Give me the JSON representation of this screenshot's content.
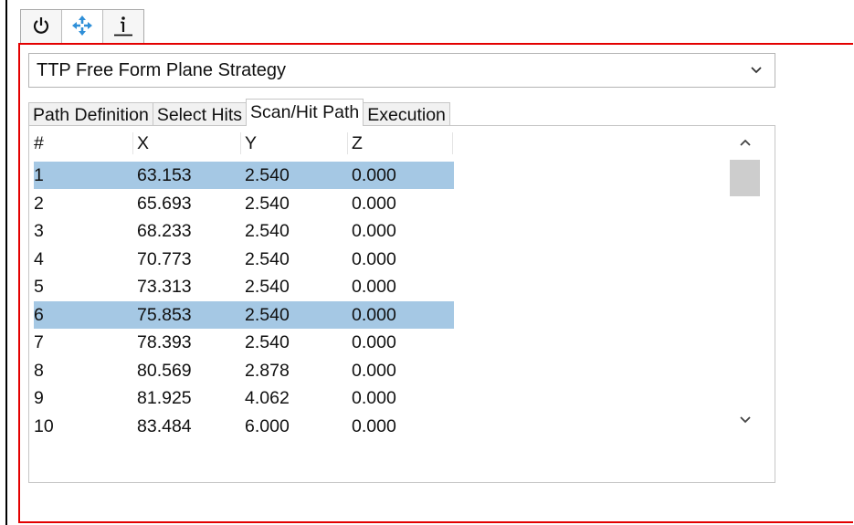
{
  "toolbar": {
    "buttons": [
      {
        "icon": "power-icon",
        "active": false
      },
      {
        "icon": "move-arrows-icon",
        "active": true
      },
      {
        "icon": "info-icon",
        "active": false
      }
    ]
  },
  "strategy": {
    "selected": "TTP Free Form Plane Strategy",
    "icon": "chevron-down-icon"
  },
  "tabs": [
    {
      "label": "Path Definition",
      "active": false
    },
    {
      "label": "Select Hits",
      "active": false
    },
    {
      "label": "Scan/Hit Path",
      "active": true
    },
    {
      "label": "Execution",
      "active": false
    }
  ],
  "grid": {
    "headers": [
      "#",
      "X",
      "Y",
      "Z"
    ],
    "selection_color": "#a5c8e4",
    "rows": [
      {
        "n": "1",
        "x": "63.153",
        "y": "2.540",
        "z": "0.000",
        "selected": true
      },
      {
        "n": "2",
        "x": "65.693",
        "y": "2.540",
        "z": "0.000",
        "selected": false
      },
      {
        "n": "3",
        "x": "68.233",
        "y": "2.540",
        "z": "0.000",
        "selected": false
      },
      {
        "n": "4",
        "x": "70.773",
        "y": "2.540",
        "z": "0.000",
        "selected": false
      },
      {
        "n": "5",
        "x": "73.313",
        "y": "2.540",
        "z": "0.000",
        "selected": false
      },
      {
        "n": "6",
        "x": "75.853",
        "y": "2.540",
        "z": "0.000",
        "selected": true
      },
      {
        "n": "7",
        "x": "78.393",
        "y": "2.540",
        "z": "0.000",
        "selected": false
      },
      {
        "n": "8",
        "x": "80.569",
        "y": "2.878",
        "z": "0.000",
        "selected": false
      },
      {
        "n": "9",
        "x": "81.925",
        "y": "4.062",
        "z": "0.000",
        "selected": false
      },
      {
        "n": "10",
        "x": "83.484",
        "y": "6.000",
        "z": "0.000",
        "selected": false
      }
    ]
  },
  "scrollbar": {
    "up_icon": "chevron-up-icon",
    "down_icon": "chevron-down-icon"
  },
  "colors": {
    "frame": "#e30000",
    "icon_blue": "#2f8fd8"
  }
}
